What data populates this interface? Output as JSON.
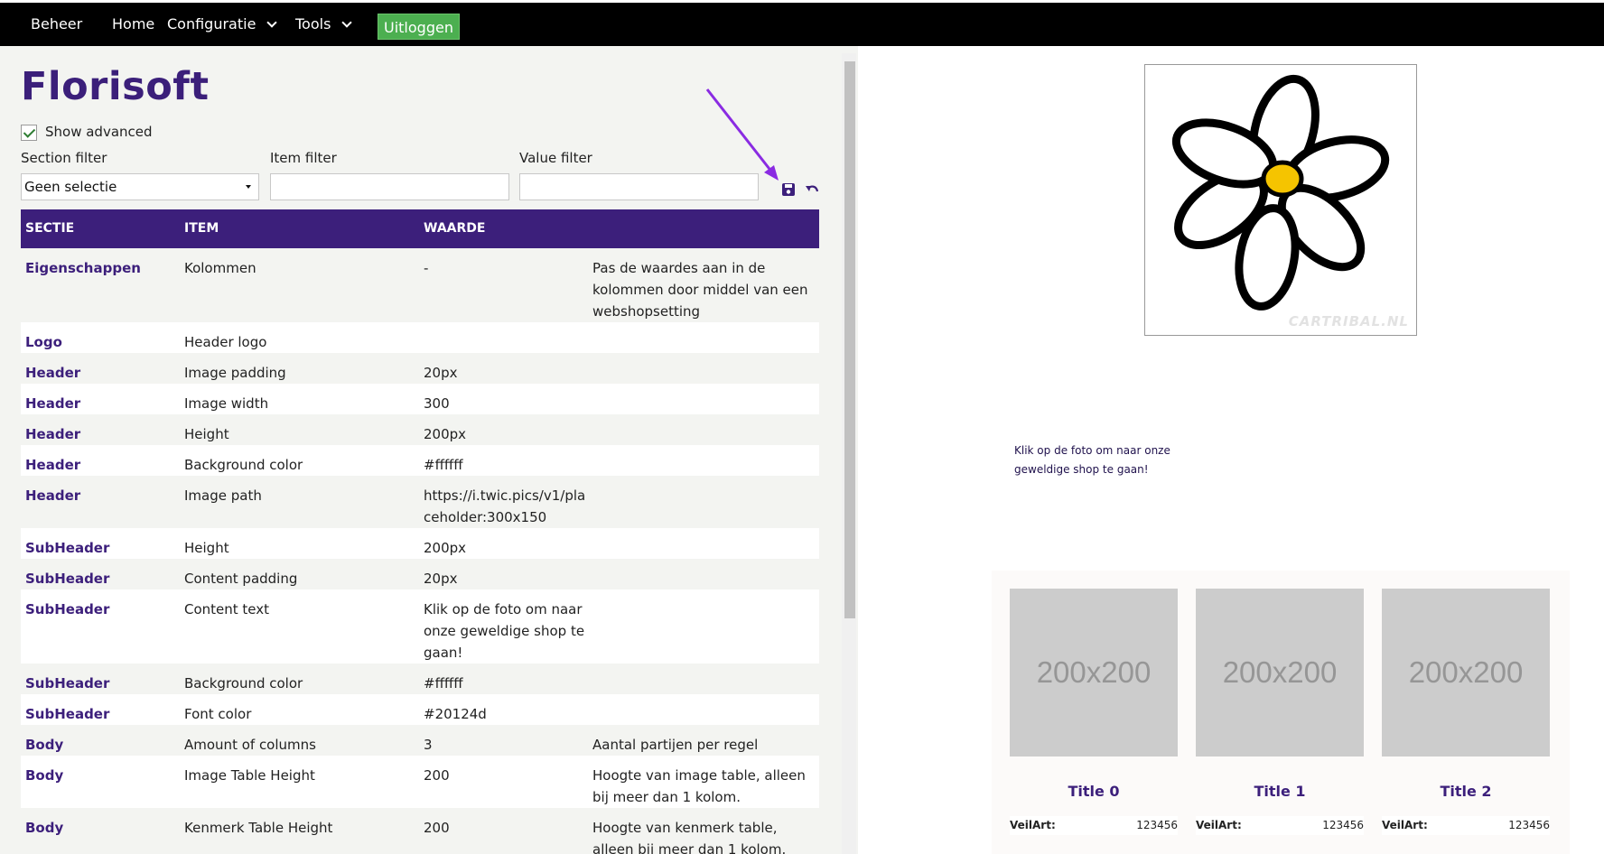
{
  "nav": {
    "brand": "Beheer",
    "home": "Home",
    "configuratie": "Configuratie",
    "tools": "Tools",
    "logout": "Uitloggen"
  },
  "brand_title": "Florisoft",
  "show_advanced": {
    "label": "Show advanced",
    "checked": true
  },
  "filters": {
    "section_label": "Section filter",
    "section_value": "Geen selectie",
    "item_label": "Item filter",
    "item_value": "",
    "value_label": "Value filter",
    "value_value": ""
  },
  "icons": {
    "save": "save-icon",
    "undo": "undo-icon"
  },
  "table": {
    "headers": [
      "SECTIE",
      "ITEM",
      "WAARDE"
    ],
    "rows": [
      {
        "section": "Eigenschappen",
        "item": "Kolommen",
        "value": "-",
        "desc": "Pas de waardes aan in de kolommen door middel van een webshopsetting"
      },
      {
        "section": "Logo",
        "item": "Header logo",
        "value": "",
        "desc": ""
      },
      {
        "section": "Header",
        "item": "Image padding",
        "value": "20px",
        "desc": ""
      },
      {
        "section": "Header",
        "item": "Image width",
        "value": "300",
        "desc": ""
      },
      {
        "section": "Header",
        "item": "Height",
        "value": "200px",
        "desc": ""
      },
      {
        "section": "Header",
        "item": "Background color",
        "value": "#ffffff",
        "desc": ""
      },
      {
        "section": "Header",
        "item": "Image path",
        "value": "https://i.twic.pics/v1/placeholder:300x150",
        "desc": ""
      },
      {
        "section": "SubHeader",
        "item": "Height",
        "value": "200px",
        "desc": ""
      },
      {
        "section": "SubHeader",
        "item": "Content padding",
        "value": "20px",
        "desc": ""
      },
      {
        "section": "SubHeader",
        "item": "Content text",
        "value": "Klik op de foto om naar onze geweldige shop te gaan!",
        "desc": ""
      },
      {
        "section": "SubHeader",
        "item": "Background color",
        "value": "#ffffff",
        "desc": ""
      },
      {
        "section": "SubHeader",
        "item": "Font color",
        "value": "#20124d",
        "desc": ""
      },
      {
        "section": "Body",
        "item": "Amount of columns",
        "value": "3",
        "desc": "Aantal partijen per regel"
      },
      {
        "section": "Body",
        "item": "Image Table Height",
        "value": "200",
        "desc": "Hoogte van image table, alleen bij meer dan 1 kolom."
      },
      {
        "section": "Body",
        "item": "Kenmerk Table Height",
        "value": "200",
        "desc": "Hoogte van kenmerk table, alleen bij meer dan 1 kolom."
      }
    ]
  },
  "preview": {
    "watermark": "CARTRIBAL.NL",
    "subheader_text": "Klik op de foto om naar onze geweldige shop te gaan!",
    "products": [
      {
        "image": "200x200",
        "title": "Title 0",
        "meta_key": "VeilArt:",
        "meta_value": "123456"
      },
      {
        "image": "200x200",
        "title": "Title 1",
        "meta_key": "VeilArt:",
        "meta_value": "123456"
      },
      {
        "image": "200x200",
        "title": "Title 2",
        "meta_key": "VeilArt:",
        "meta_value": "123456"
      }
    ]
  },
  "colors": {
    "brand_purple": "#3c1f7b",
    "logout_green": "#4caf50",
    "topbar": "#000000",
    "annotation_arrow": "#8a2be2"
  }
}
